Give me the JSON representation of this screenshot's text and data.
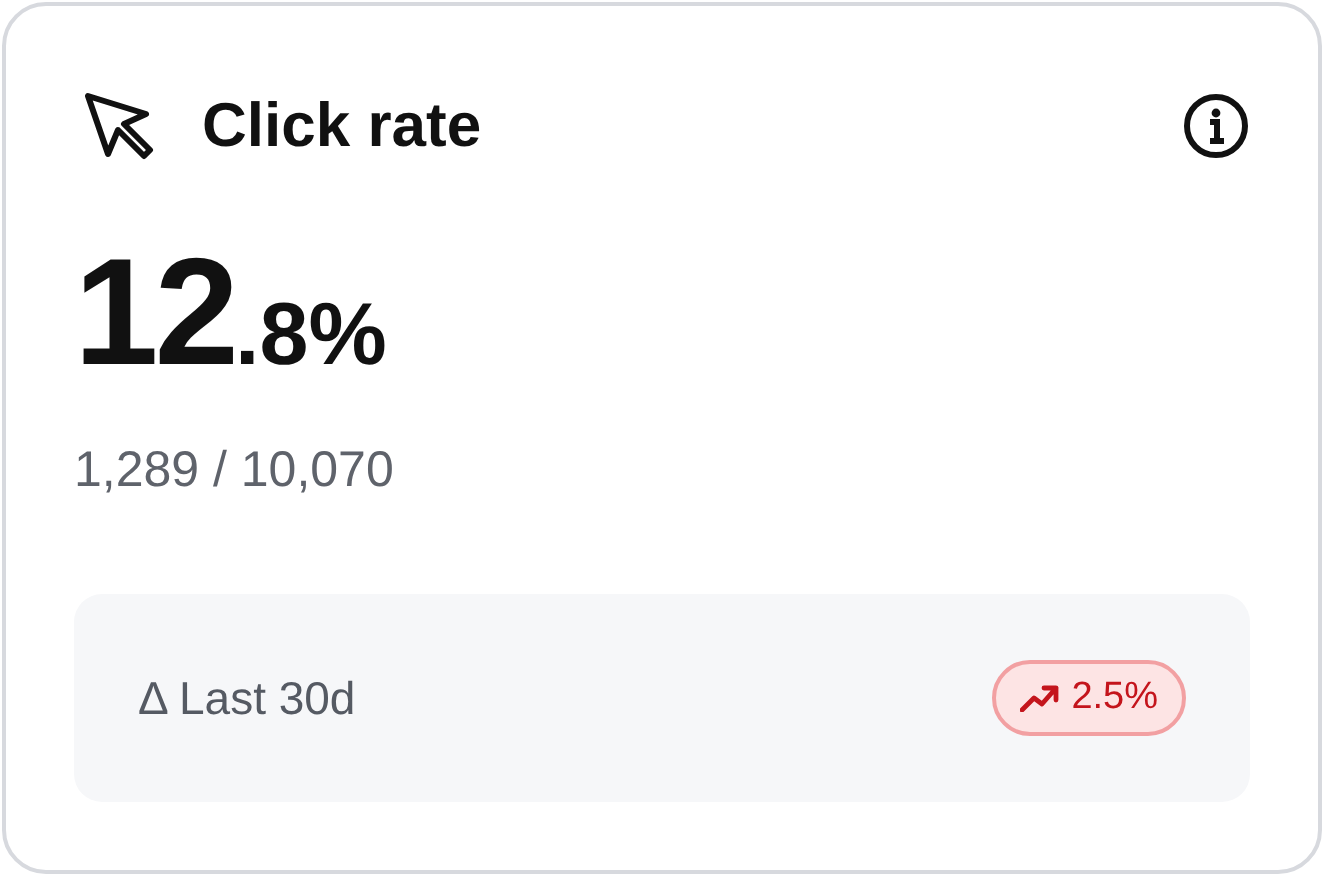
{
  "card": {
    "title": "Click rate",
    "value": {
      "whole": "12",
      "fraction": ".8%"
    },
    "detail": "1,289 / 10,070",
    "comparison": {
      "label": "Δ Last 30d",
      "change": "2.5%",
      "rising": true
    }
  }
}
